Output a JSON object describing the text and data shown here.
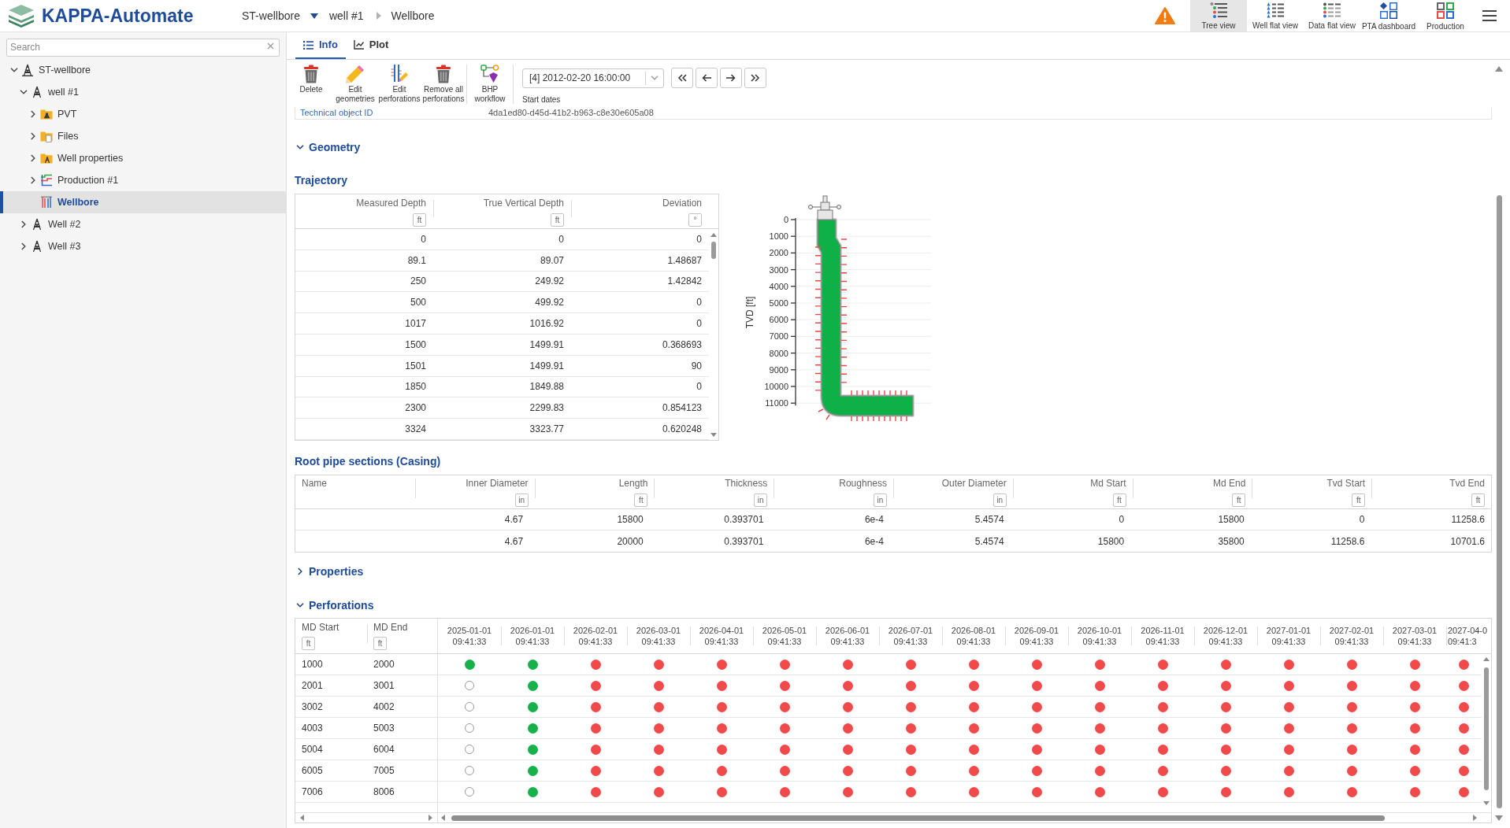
{
  "header": {
    "app_title": "KAPPA-Automate",
    "breadcrumb": [
      {
        "label": "ST-wellbore",
        "kind": "dropdown"
      },
      {
        "label": "well #1",
        "kind": "link"
      },
      {
        "label": "Wellbore",
        "kind": "current"
      }
    ],
    "views": [
      {
        "label": "Tree view",
        "kind": "tree",
        "selected": true
      },
      {
        "label": "Well flat view",
        "kind": "well-flat",
        "selected": false
      },
      {
        "label": "Data flat view",
        "kind": "data-flat",
        "selected": false
      },
      {
        "label": "PTA dashboard",
        "kind": "dashboard",
        "selected": false
      },
      {
        "label": "Production",
        "kind": "production",
        "selected": false
      }
    ]
  },
  "sidebar": {
    "search": {
      "placeholder": "Search"
    },
    "tree": [
      {
        "label": "ST-wellbore",
        "kind": "field",
        "expanded": true,
        "selected": false,
        "children": [
          {
            "label": "well #1",
            "kind": "well",
            "expanded": true,
            "selected": false,
            "children": [
              {
                "label": "PVT",
                "kind": "pvt",
                "expanded": false,
                "selected": false
              },
              {
                "label": "Files",
                "kind": "folder",
                "expanded": false,
                "selected": false
              },
              {
                "label": "Well properties",
                "kind": "properties",
                "expanded": false,
                "selected": false
              },
              {
                "label": "Production #1",
                "kind": "production",
                "expanded": false,
                "selected": false
              },
              {
                "label": "Wellbore",
                "kind": "wellbore",
                "selected": true
              }
            ]
          },
          {
            "label": "Well #2",
            "kind": "well",
            "expanded": false,
            "selected": false
          },
          {
            "label": "Well #3",
            "kind": "well",
            "expanded": false,
            "selected": false
          }
        ]
      }
    ]
  },
  "tabs": [
    {
      "label": "Info",
      "kind": "list",
      "selected": true
    },
    {
      "label": "Plot",
      "kind": "chart",
      "selected": false
    }
  ],
  "toolbar": {
    "groups": [
      {
        "actions": [
          {
            "label": "Delete",
            "kind": "delete"
          },
          {
            "label": "Edit geometries",
            "kind": "edit"
          },
          {
            "label": "Edit perforations",
            "kind": "edit-perforations"
          },
          {
            "label": "Remove all perforations",
            "kind": "delete"
          }
        ]
      },
      {
        "actions": [
          {
            "label": "BHP workflow",
            "kind": "workflow"
          }
        ]
      }
    ],
    "start_dates": {
      "value": "[4] 2012-02-20 16:00:00",
      "label": "Start dates"
    }
  },
  "info": {
    "label": "Technical object ID",
    "value": "4da1ed80-d45d-41b2-b963-c8e30e605a08"
  },
  "geometry": {
    "title": "Geometry",
    "expanded": true,
    "trajectory": {
      "title": "Trajectory",
      "columns": [
        {
          "label": "Measured Depth",
          "unit": "ft"
        },
        {
          "label": "True Vertical Depth",
          "unit": "ft"
        },
        {
          "label": "Deviation",
          "unit": "°"
        }
      ],
      "rows": [
        [
          "0",
          "0",
          "0"
        ],
        [
          "89.1",
          "89.07",
          "1.48687"
        ],
        [
          "250",
          "249.92",
          "1.42842"
        ],
        [
          "500",
          "499.92",
          "0"
        ],
        [
          "1017",
          "1016.92",
          "0"
        ],
        [
          "1500",
          "1499.91",
          "0.368693"
        ],
        [
          "1501",
          "1499.91",
          "90"
        ],
        [
          "1850",
          "1849.88",
          "0"
        ],
        [
          "2300",
          "2299.83",
          "0.854123"
        ],
        [
          "3324",
          "3323.77",
          "0.620248"
        ]
      ]
    },
    "wellbore_plot": {
      "axis_title": "TVD [ft]",
      "ticks": [
        "0",
        "1000",
        "2000",
        "3000",
        "4000",
        "5000",
        "6000",
        "7000",
        "8000",
        "9000",
        "10000",
        "11000"
      ]
    },
    "casing": {
      "title": "Root pipe sections (Casing)",
      "columns": [
        {
          "label": "Name",
          "kind": "text"
        },
        {
          "label": "Inner Diameter",
          "unit": "in",
          "kind": "number"
        },
        {
          "label": "Length",
          "unit": "ft",
          "kind": "number"
        },
        {
          "label": "Thickness",
          "unit": "in",
          "kind": "number"
        },
        {
          "label": "Roughness",
          "unit": "in",
          "kind": "number"
        },
        {
          "label": "Outer Diameter",
          "unit": "in",
          "kind": "number"
        },
        {
          "label": "Md Start",
          "unit": "ft",
          "kind": "number"
        },
        {
          "label": "Md End",
          "unit": "ft",
          "kind": "number"
        },
        {
          "label": "Tvd Start",
          "unit": "ft",
          "kind": "number"
        },
        {
          "label": "Tvd End",
          "unit": "ft",
          "kind": "number"
        }
      ],
      "rows": [
        [
          null,
          "4.67",
          "15800",
          "0.393701",
          "6e-4",
          "5.4574",
          "0",
          "15800",
          "0",
          "11258.6"
        ],
        [
          null,
          "4.67",
          "20000",
          "0.393701",
          "6e-4",
          "5.4574",
          "15800",
          "35800",
          "11258.6",
          "10701.6"
        ]
      ]
    }
  },
  "properties": {
    "title": "Properties",
    "expanded": false
  },
  "perforations": {
    "title": "Perforations",
    "expanded": true,
    "columns": [
      {
        "label": "MD Start",
        "unit": "ft"
      },
      {
        "label": "MD End",
        "unit": "ft"
      }
    ],
    "dates": [
      {
        "date": "2025-01-01",
        "time": "09:41:33"
      },
      {
        "date": "2026-01-01",
        "time": "09:41:33"
      },
      {
        "date": "2026-02-01",
        "time": "09:41:33"
      },
      {
        "date": "2026-03-01",
        "time": "09:41:33"
      },
      {
        "date": "2026-04-01",
        "time": "09:41:33"
      },
      {
        "date": "2026-05-01",
        "time": "09:41:33"
      },
      {
        "date": "2026-06-01",
        "time": "09:41:33"
      },
      {
        "date": "2026-07-01",
        "time": "09:41:33"
      },
      {
        "date": "2026-08-01",
        "time": "09:41:33"
      },
      {
        "date": "2026-09-01",
        "time": "09:41:33"
      },
      {
        "date": "2026-10-01",
        "time": "09:41:33"
      },
      {
        "date": "2026-11-01",
        "time": "09:41:33"
      },
      {
        "date": "2026-12-01",
        "time": "09:41:33"
      },
      {
        "date": "2027-01-01",
        "time": "09:41:33"
      },
      {
        "date": "2027-02-01",
        "time": "09:41:33"
      },
      {
        "date": "2027-03-01",
        "time": "09:41:33"
      },
      {
        "date": "2027-04-0",
        "time": "09:41:3"
      }
    ],
    "rows": [
      {
        "md_start": "1000",
        "md_end": "2000",
        "cells": [
          {
            "kind": "dot",
            "color": "#16b14b"
          },
          {
            "kind": "dot",
            "color": "#16b14b"
          },
          {
            "kind": "dot",
            "color": "#f24a4a"
          },
          {
            "kind": "dot",
            "color": "#f24a4a"
          },
          {
            "kind": "dot",
            "color": "#f24a4a"
          },
          {
            "kind": "dot",
            "color": "#f24a4a"
          },
          {
            "kind": "dot",
            "color": "#f24a4a"
          },
          {
            "kind": "dot",
            "color": "#f24a4a"
          },
          {
            "kind": "dot",
            "color": "#f24a4a"
          },
          {
            "kind": "dot",
            "color": "#f24a4a"
          },
          {
            "kind": "dot",
            "color": "#f24a4a"
          },
          {
            "kind": "dot",
            "color": "#f24a4a"
          },
          {
            "kind": "dot",
            "color": "#f24a4a"
          },
          {
            "kind": "dot",
            "color": "#f24a4a"
          },
          {
            "kind": "dot",
            "color": "#f24a4a"
          },
          {
            "kind": "dot",
            "color": "#f24a4a"
          },
          {
            "kind": "dot",
            "color": "#f24a4a"
          }
        ]
      },
      {
        "md_start": "2001",
        "md_end": "3001",
        "cells": [
          {
            "kind": "empty"
          },
          {
            "kind": "dot",
            "color": "#16b14b"
          },
          {
            "kind": "dot",
            "color": "#f24a4a"
          },
          {
            "kind": "dot",
            "color": "#f24a4a"
          },
          {
            "kind": "dot",
            "color": "#f24a4a"
          },
          {
            "kind": "dot",
            "color": "#f24a4a"
          },
          {
            "kind": "dot",
            "color": "#f24a4a"
          },
          {
            "kind": "dot",
            "color": "#f24a4a"
          },
          {
            "kind": "dot",
            "color": "#f24a4a"
          },
          {
            "kind": "dot",
            "color": "#f24a4a"
          },
          {
            "kind": "dot",
            "color": "#f24a4a"
          },
          {
            "kind": "dot",
            "color": "#f24a4a"
          },
          {
            "kind": "dot",
            "color": "#f24a4a"
          },
          {
            "kind": "dot",
            "color": "#f24a4a"
          },
          {
            "kind": "dot",
            "color": "#f24a4a"
          },
          {
            "kind": "dot",
            "color": "#f24a4a"
          },
          {
            "kind": "dot",
            "color": "#f24a4a"
          }
        ]
      },
      {
        "md_start": "3002",
        "md_end": "4002",
        "cells": [
          {
            "kind": "empty"
          },
          {
            "kind": "dot",
            "color": "#16b14b"
          },
          {
            "kind": "dot",
            "color": "#f24a4a"
          },
          {
            "kind": "dot",
            "color": "#f24a4a"
          },
          {
            "kind": "dot",
            "color": "#f24a4a"
          },
          {
            "kind": "dot",
            "color": "#f24a4a"
          },
          {
            "kind": "dot",
            "color": "#f24a4a"
          },
          {
            "kind": "dot",
            "color": "#f24a4a"
          },
          {
            "kind": "dot",
            "color": "#f24a4a"
          },
          {
            "kind": "dot",
            "color": "#f24a4a"
          },
          {
            "kind": "dot",
            "color": "#f24a4a"
          },
          {
            "kind": "dot",
            "color": "#f24a4a"
          },
          {
            "kind": "dot",
            "color": "#f24a4a"
          },
          {
            "kind": "dot",
            "color": "#f24a4a"
          },
          {
            "kind": "dot",
            "color": "#f24a4a"
          },
          {
            "kind": "dot",
            "color": "#f24a4a"
          },
          {
            "kind": "dot",
            "color": "#f24a4a"
          }
        ]
      },
      {
        "md_start": "4003",
        "md_end": "5003",
        "cells": [
          {
            "kind": "empty"
          },
          {
            "kind": "dot",
            "color": "#16b14b"
          },
          {
            "kind": "dot",
            "color": "#f24a4a"
          },
          {
            "kind": "dot",
            "color": "#f24a4a"
          },
          {
            "kind": "dot",
            "color": "#f24a4a"
          },
          {
            "kind": "dot",
            "color": "#f24a4a"
          },
          {
            "kind": "dot",
            "color": "#f24a4a"
          },
          {
            "kind": "dot",
            "color": "#f24a4a"
          },
          {
            "kind": "dot",
            "color": "#f24a4a"
          },
          {
            "kind": "dot",
            "color": "#f24a4a"
          },
          {
            "kind": "dot",
            "color": "#f24a4a"
          },
          {
            "kind": "dot",
            "color": "#f24a4a"
          },
          {
            "kind": "dot",
            "color": "#f24a4a"
          },
          {
            "kind": "dot",
            "color": "#f24a4a"
          },
          {
            "kind": "dot",
            "color": "#f24a4a"
          },
          {
            "kind": "dot",
            "color": "#f24a4a"
          },
          {
            "kind": "dot",
            "color": "#f24a4a"
          }
        ]
      },
      {
        "md_start": "5004",
        "md_end": "6004",
        "cells": [
          {
            "kind": "empty"
          },
          {
            "kind": "dot",
            "color": "#16b14b"
          },
          {
            "kind": "dot",
            "color": "#f24a4a"
          },
          {
            "kind": "dot",
            "color": "#f24a4a"
          },
          {
            "kind": "dot",
            "color": "#f24a4a"
          },
          {
            "kind": "dot",
            "color": "#f24a4a"
          },
          {
            "kind": "dot",
            "color": "#f24a4a"
          },
          {
            "kind": "dot",
            "color": "#f24a4a"
          },
          {
            "kind": "dot",
            "color": "#f24a4a"
          },
          {
            "kind": "dot",
            "color": "#f24a4a"
          },
          {
            "kind": "dot",
            "color": "#f24a4a"
          },
          {
            "kind": "dot",
            "color": "#f24a4a"
          },
          {
            "kind": "dot",
            "color": "#f24a4a"
          },
          {
            "kind": "dot",
            "color": "#f24a4a"
          },
          {
            "kind": "dot",
            "color": "#f24a4a"
          },
          {
            "kind": "dot",
            "color": "#f24a4a"
          },
          {
            "kind": "dot",
            "color": "#f24a4a"
          }
        ]
      },
      {
        "md_start": "6005",
        "md_end": "7005",
        "cells": [
          {
            "kind": "empty"
          },
          {
            "kind": "dot",
            "color": "#16b14b"
          },
          {
            "kind": "dot",
            "color": "#f24a4a"
          },
          {
            "kind": "dot",
            "color": "#f24a4a"
          },
          {
            "kind": "dot",
            "color": "#f24a4a"
          },
          {
            "kind": "dot",
            "color": "#f24a4a"
          },
          {
            "kind": "dot",
            "color": "#f24a4a"
          },
          {
            "kind": "dot",
            "color": "#f24a4a"
          },
          {
            "kind": "dot",
            "color": "#f24a4a"
          },
          {
            "kind": "dot",
            "color": "#f24a4a"
          },
          {
            "kind": "dot",
            "color": "#f24a4a"
          },
          {
            "kind": "dot",
            "color": "#f24a4a"
          },
          {
            "kind": "dot",
            "color": "#f24a4a"
          },
          {
            "kind": "dot",
            "color": "#f24a4a"
          },
          {
            "kind": "dot",
            "color": "#f24a4a"
          },
          {
            "kind": "dot",
            "color": "#f24a4a"
          },
          {
            "kind": "dot",
            "color": "#f24a4a"
          }
        ]
      },
      {
        "md_start": "7006",
        "md_end": "8006",
        "cells": [
          {
            "kind": "empty"
          },
          {
            "kind": "dot",
            "color": "#16b14b"
          },
          {
            "kind": "dot",
            "color": "#f24a4a"
          },
          {
            "kind": "dot",
            "color": "#f24a4a"
          },
          {
            "kind": "dot",
            "color": "#f24a4a"
          },
          {
            "kind": "dot",
            "color": "#f24a4a"
          },
          {
            "kind": "dot",
            "color": "#f24a4a"
          },
          {
            "kind": "dot",
            "color": "#f24a4a"
          },
          {
            "kind": "dot",
            "color": "#f24a4a"
          },
          {
            "kind": "dot",
            "color": "#f24a4a"
          },
          {
            "kind": "dot",
            "color": "#f24a4a"
          },
          {
            "kind": "dot",
            "color": "#f24a4a"
          },
          {
            "kind": "dot",
            "color": "#f24a4a"
          },
          {
            "kind": "dot",
            "color": "#f24a4a"
          },
          {
            "kind": "dot",
            "color": "#f24a4a"
          },
          {
            "kind": "dot",
            "color": "#f24a4a"
          },
          {
            "kind": "dot",
            "color": "#f24a4a"
          }
        ]
      }
    ]
  }
}
